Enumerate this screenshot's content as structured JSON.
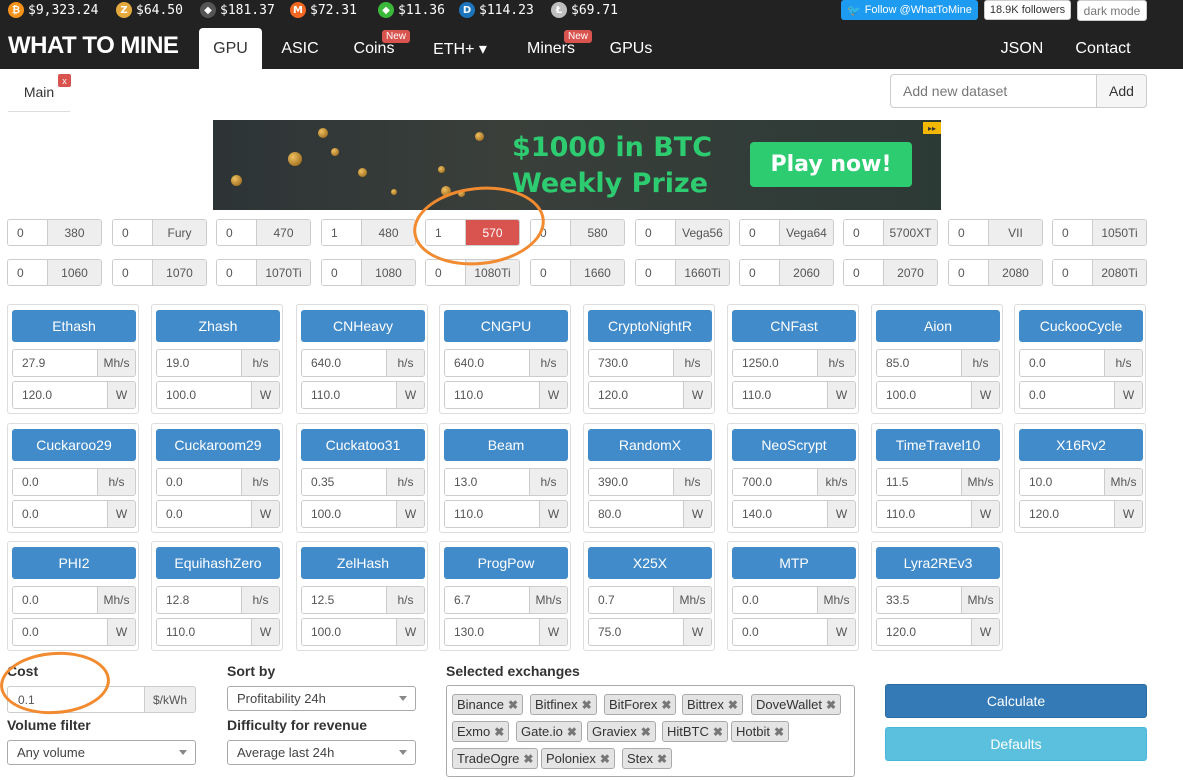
{
  "ticker": [
    {
      "icon": "bitcoin-icon",
      "symbol": "₿",
      "color": "#f7931a",
      "price": "$9,323.24"
    },
    {
      "icon": "zcash-icon",
      "symbol": "Z",
      "color": "#e5a93d",
      "price": "$64.50"
    },
    {
      "icon": "ethereum-icon",
      "symbol": "◆",
      "color": "#555555",
      "price": "$181.37"
    },
    {
      "icon": "monero-icon",
      "symbol": "M",
      "color": "#f26822",
      "price": "$72.31"
    },
    {
      "icon": "ethereum-classic-icon",
      "symbol": "◆",
      "color": "#3ab83a",
      "price": "$11.36"
    },
    {
      "icon": "dash-icon",
      "symbol": "D",
      "color": "#1c75bc",
      "price": "$114.23"
    },
    {
      "icon": "litecoin-icon",
      "symbol": "Ł",
      "color": "#bebebe",
      "price": "$69.71"
    }
  ],
  "social": {
    "follow": "Follow @WhatToMine",
    "followers": "18.9K followers",
    "dark_mode": "dark mode"
  },
  "nav": {
    "brand": "WHAT TO MINE",
    "items": [
      {
        "label": "GPU"
      },
      {
        "label": "ASIC"
      },
      {
        "label": "Coins",
        "badge": "New"
      },
      {
        "label": "ETH+ ▾"
      },
      {
        "label": "Miners",
        "badge": "New"
      },
      {
        "label": "GPUs"
      }
    ],
    "right": [
      {
        "label": "JSON"
      },
      {
        "label": "Contact"
      }
    ]
  },
  "tabs": {
    "main": "Main",
    "close": "x"
  },
  "dataset": {
    "placeholder": "Add new dataset",
    "add": "Add"
  },
  "banner": {
    "line1": "$1000 in BTC",
    "line2": "Weekly Prize",
    "cta": "Play now!"
  },
  "gpus": [
    [
      {
        "count": "0",
        "label": "380"
      },
      {
        "count": "0",
        "label": "Fury"
      },
      {
        "count": "0",
        "label": "470"
      },
      {
        "count": "1",
        "label": "480"
      },
      {
        "count": "1",
        "label": "570"
      },
      {
        "count": "0",
        "label": "580"
      },
      {
        "count": "0",
        "label": "Vega56"
      },
      {
        "count": "0",
        "label": "Vega64"
      },
      {
        "count": "0",
        "label": "5700XT"
      },
      {
        "count": "0",
        "label": "VII"
      },
      {
        "count": "0",
        "label": "1050Ti"
      }
    ],
    [
      {
        "count": "0",
        "label": "1060"
      },
      {
        "count": "0",
        "label": "1070"
      },
      {
        "count": "0",
        "label": "1070Ti"
      },
      {
        "count": "0",
        "label": "1080"
      },
      {
        "count": "0",
        "label": "1080Ti"
      },
      {
        "count": "0",
        "label": "1660"
      },
      {
        "count": "0",
        "label": "1660Ti"
      },
      {
        "count": "0",
        "label": "2060"
      },
      {
        "count": "0",
        "label": "2070"
      },
      {
        "count": "0",
        "label": "2080"
      },
      {
        "count": "0",
        "label": "2080Ti"
      }
    ]
  ],
  "algorithms": [
    [
      {
        "name": "Ethash",
        "hashrate": "27.9",
        "hunit": "Mh/s",
        "power": "120.0",
        "punit": "W"
      },
      {
        "name": "Zhash",
        "hashrate": "19.0",
        "hunit": "h/s",
        "power": "100.0",
        "punit": "W"
      },
      {
        "name": "CNHeavy",
        "hashrate": "640.0",
        "hunit": "h/s",
        "power": "110.0",
        "punit": "W"
      },
      {
        "name": "CNGPU",
        "hashrate": "640.0",
        "hunit": "h/s",
        "power": "110.0",
        "punit": "W"
      },
      {
        "name": "CryptoNightR",
        "hashrate": "730.0",
        "hunit": "h/s",
        "power": "120.0",
        "punit": "W"
      },
      {
        "name": "CNFast",
        "hashrate": "1250.0",
        "hunit": "h/s",
        "power": "110.0",
        "punit": "W"
      },
      {
        "name": "Aion",
        "hashrate": "85.0",
        "hunit": "h/s",
        "power": "100.0",
        "punit": "W"
      },
      {
        "name": "CuckooCycle",
        "hashrate": "0.0",
        "hunit": "h/s",
        "power": "0.0",
        "punit": "W"
      }
    ],
    [
      {
        "name": "Cuckaroo29",
        "hashrate": "0.0",
        "hunit": "h/s",
        "power": "0.0",
        "punit": "W"
      },
      {
        "name": "Cuckaroom29",
        "hashrate": "0.0",
        "hunit": "h/s",
        "power": "0.0",
        "punit": "W"
      },
      {
        "name": "Cuckatoo31",
        "hashrate": "0.35",
        "hunit": "h/s",
        "power": "100.0",
        "punit": "W"
      },
      {
        "name": "Beam",
        "hashrate": "13.0",
        "hunit": "h/s",
        "power": "110.0",
        "punit": "W"
      },
      {
        "name": "RandomX",
        "hashrate": "390.0",
        "hunit": "h/s",
        "power": "80.0",
        "punit": "W"
      },
      {
        "name": "NeoScrypt",
        "hashrate": "700.0",
        "hunit": "kh/s",
        "power": "140.0",
        "punit": "W"
      },
      {
        "name": "TimeTravel10",
        "hashrate": "11.5",
        "hunit": "Mh/s",
        "power": "110.0",
        "punit": "W"
      },
      {
        "name": "X16Rv2",
        "hashrate": "10.0",
        "hunit": "Mh/s",
        "power": "120.0",
        "punit": "W"
      }
    ],
    [
      {
        "name": "PHI2",
        "hashrate": "0.0",
        "hunit": "Mh/s",
        "power": "0.0",
        "punit": "W"
      },
      {
        "name": "EquihashZero",
        "hashrate": "12.8",
        "hunit": "h/s",
        "power": "110.0",
        "punit": "W"
      },
      {
        "name": "ZelHash",
        "hashrate": "12.5",
        "hunit": "h/s",
        "power": "100.0",
        "punit": "W"
      },
      {
        "name": "ProgPow",
        "hashrate": "6.7",
        "hunit": "Mh/s",
        "power": "130.0",
        "punit": "W"
      },
      {
        "name": "X25X",
        "hashrate": "0.7",
        "hunit": "Mh/s",
        "power": "75.0",
        "punit": "W"
      },
      {
        "name": "MTP",
        "hashrate": "0.0",
        "hunit": "Mh/s",
        "power": "0.0",
        "punit": "W"
      },
      {
        "name": "Lyra2REv3",
        "hashrate": "33.5",
        "hunit": "Mh/s",
        "power": "120.0",
        "punit": "W"
      }
    ]
  ],
  "form": {
    "cost_label": "Cost",
    "cost_value": "0.1",
    "cost_unit": "$/kWh",
    "volume_label": "Volume filter",
    "volume_value": "Any volume",
    "sort_label": "Sort by",
    "sort_value": "Profitability 24h",
    "difficulty_label": "Difficulty for revenue",
    "difficulty_value": "Average last 24h",
    "exchanges_label": "Selected exchanges",
    "exchanges": [
      "Binance",
      "Bitfinex",
      "BitForex",
      "Bittrex",
      "DoveWallet",
      "Exmo",
      "Gate.io",
      "Graviex",
      "HitBTC",
      "Hotbit",
      "TradeOgre",
      "Poloniex",
      "Stex"
    ],
    "calculate": "Calculate",
    "defaults": "Defaults"
  },
  "colors": {
    "accent": "#428bca",
    "highlight": "#d9534f",
    "annotation": "#f28a30"
  }
}
